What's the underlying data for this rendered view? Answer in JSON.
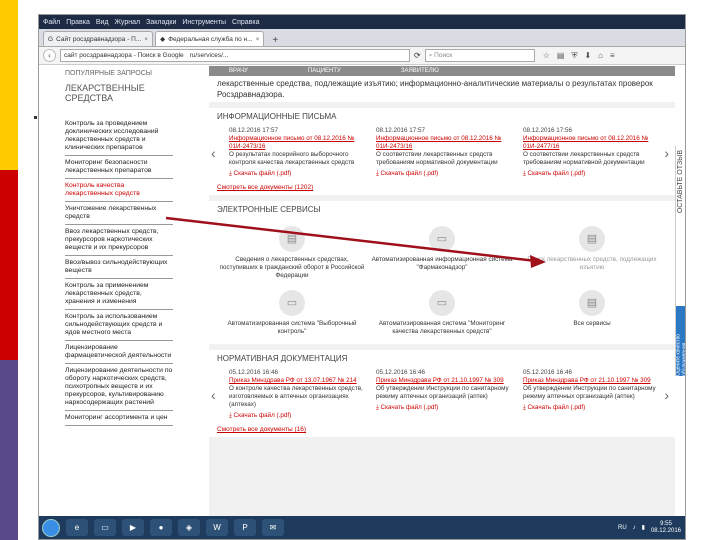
{
  "window": {
    "menu": [
      "Файл",
      "Правка",
      "Вид",
      "Журнал",
      "Закладки",
      "Инструменты",
      "Справка"
    ],
    "tabs": [
      {
        "label": "Сайт росздравнадзора - П..."
      },
      {
        "label": "Федеральная служба по н..."
      }
    ],
    "address": "сайт росздравнадзора - Поиск в Google",
    "address_path": "ru/services/...",
    "search_placeholder": "Поиск"
  },
  "sidebar": {
    "popular": "ПОПУЛЯРНЫЕ ЗАПРОСЫ",
    "heading": "ЛЕКАРСТВЕННЫЕ СРЕДСТВА",
    "items": [
      {
        "label": "Контроль за проведением доклинических исследований лекарственных средств и клинических препаратов"
      },
      {
        "label": "Мониторинг безопасности лекарственных препаратов"
      },
      {
        "label": "Контроль качества лекарственных средств"
      },
      {
        "label": "Уничтожение лекарственных средств"
      },
      {
        "label": "Ввоз лекарственных средств, прекурсоров наркотических веществ и их прекурсоров"
      },
      {
        "label": "Ввоз/вывоз сильнодействующих веществ"
      },
      {
        "label": "Контроль за применением лекарственных средств, хранения и изменения"
      },
      {
        "label": "Контроль за использованием сильнодействующих средств и ядов местного места"
      },
      {
        "label": "Лицензирование фармацевтической деятельности"
      },
      {
        "label": "Лицензирование деятельности по обороту наркотических средств, психотропных веществ и их прекурсоров, культивированию наркосодержащих растений"
      },
      {
        "label": "Мониторинг ассортимента и цен"
      }
    ]
  },
  "main": {
    "strip": [
      "ВРАЧУ",
      "ПАЦИЕНТУ",
      "ЗАЯВИТЕЛЮ"
    ],
    "intro": "лекарственные средства, подлежащие изъятию; информационно-аналитические материалы о результатах проверок Росздравнадзора.",
    "letters_title": "ИНФОРМАЦИОННЫЕ ПИСЬМА",
    "letters": [
      {
        "date": "08.12.2016 17:57",
        "link": "Информационное письмо от 08.12.2016 № 01И-2473/16",
        "text": "О результатах посерийного выборочного контроля качества лекарственных средств",
        "dl": "Скачать файл (.pdf)"
      },
      {
        "date": "08.12.2016 17:57",
        "link": "Информационное письмо от 08.12.2016 № 01И-2473/16",
        "text": "О соответствии лекарственных средств требованиям нормативной документации",
        "dl": "Скачать файл (.pdf)"
      },
      {
        "date": "08.12.2016 17:56",
        "link": "Информационное письмо от 08.12.2016 № 01И-2477/16",
        "text": "О соответствии лекарственных средств требованиям нормативной документации",
        "dl": "Скачать файл (.pdf)"
      }
    ],
    "letters_more": "Смотреть все документы (1202)",
    "services_title": "ЭЛЕКТРОННЫЕ СЕРВИСЫ",
    "services": [
      {
        "label": "Сведения о лекарственных средствах, поступивших в гражданский оборот в Российской Федерации"
      },
      {
        "label": "Автоматизированная информационная система \"Фармаконадзор\""
      },
      {
        "label": "Поиск лекарственных средств, подлежащих изъятию"
      },
      {
        "label": "Автоматизированная система \"Выборочный контроль\""
      },
      {
        "label": "Автоматизированная система \"Мониторинг качества лекарственных средств\""
      },
      {
        "label": "Все сервисы"
      }
    ],
    "docs_title": "НОРМАТИВНАЯ ДОКУМЕНТАЦИЯ",
    "docs": [
      {
        "date": "05.12.2016 16:46",
        "link": "Приказ Минздрава РФ от 13.07.1967 № 214",
        "text": "О контроле качества лекарственных средств, изготовляемых в аптечных организациях (аптеках)",
        "dl": "Скачать файл (.pdf)"
      },
      {
        "date": "05.12.2016 16:46",
        "link": "Приказ Минздрава РФ от 21.10.1997 № 309",
        "text": "Об утверждении Инструкции по санитарному режиму аптечных организаций (аптек)",
        "dl": "Скачать файл (.pdf)"
      },
      {
        "date": "05.12.2016 16:46",
        "link": "Приказ Минздрава РФ от 21.10.1997 № 309",
        "text": "Об утверждении Инструкции по санитарному режиму аптечных организаций (аптек)",
        "dl": "Скачать файл (.pdf)"
      }
    ],
    "docs_more": "Смотреть все документы (16)"
  },
  "side_vote": {
    "label": "ОСТАВЬТЕ ОТЗЫВ",
    "badge": "Оцените качество обслуживания"
  },
  "taskbar": {
    "lang": "RU",
    "time": "9:55",
    "date": "08.12.2016"
  }
}
